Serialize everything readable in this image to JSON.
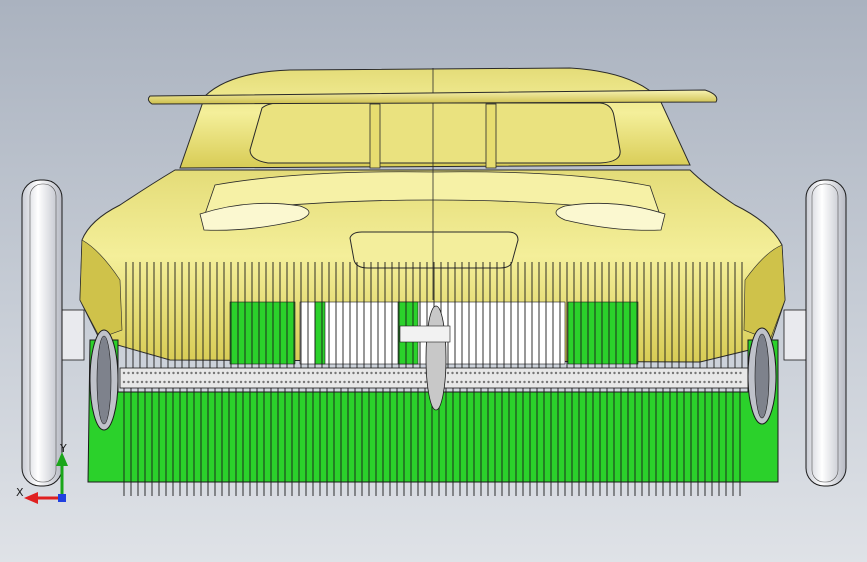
{
  "viewport": {
    "background_top": "#aab2bf",
    "background_bottom": "#dfe2e7"
  },
  "model": {
    "body_color": "#f2ec8a",
    "body_shade": "#d8cc55",
    "board_color": "#2bd12b",
    "wheel_color": "#e6e8ee",
    "edge_color": "#2a2a2a"
  },
  "triad": {
    "x_label": "X",
    "y_label": "Y",
    "x_color": "#e02020",
    "y_color": "#1aa61a",
    "z_color": "#2040e0"
  }
}
